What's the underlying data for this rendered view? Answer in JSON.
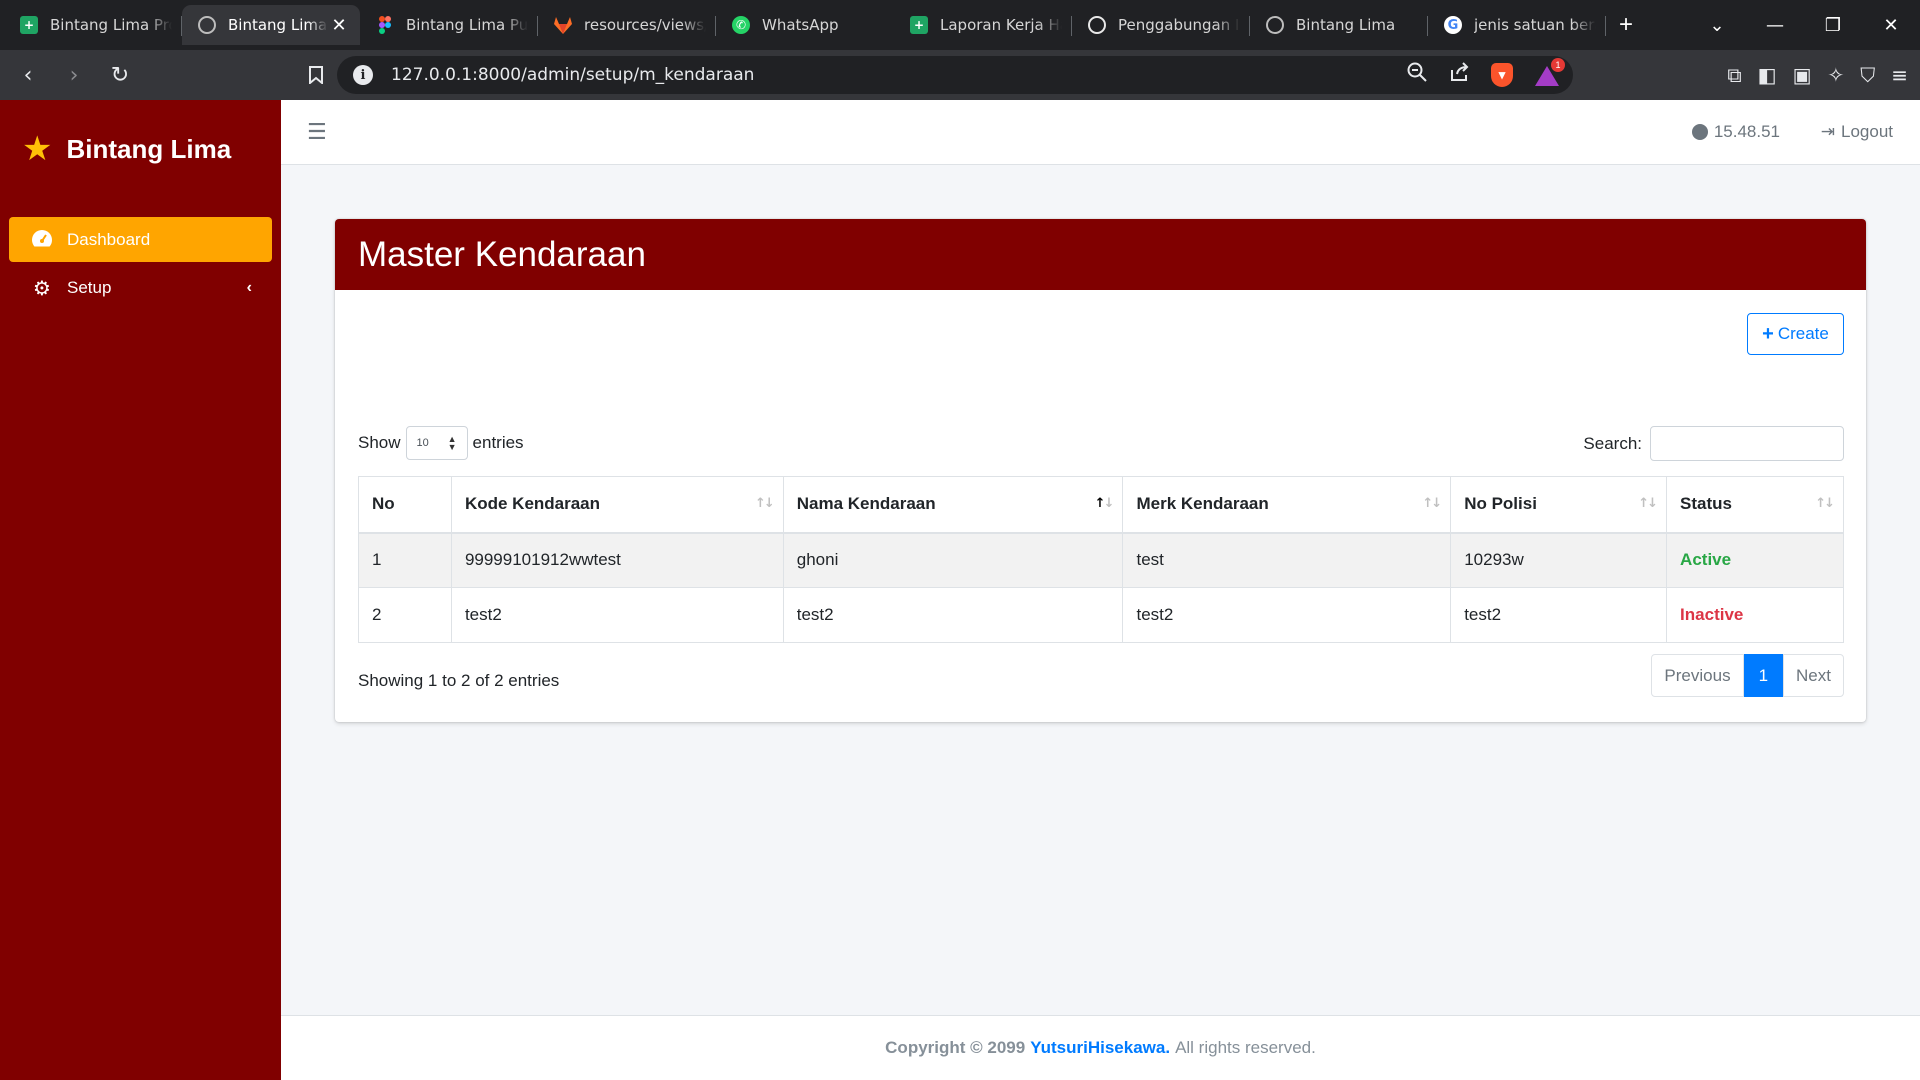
{
  "browser": {
    "tabs": [
      {
        "title": "Bintang Lima Proj",
        "icon": "sheets-icon",
        "active": false
      },
      {
        "title": "Bintang Lima",
        "icon": "globe-icon",
        "active": true
      },
      {
        "title": "Bintang Lima Putr",
        "icon": "figma-icon",
        "active": false
      },
      {
        "title": "resources/views/fr",
        "icon": "gitlab-icon",
        "active": false
      },
      {
        "title": "WhatsApp",
        "icon": "whatsapp-icon",
        "active": false
      },
      {
        "title": "Laporan Kerja Har",
        "icon": "sheets-icon",
        "active": false
      },
      {
        "title": "Penggabungan In",
        "icon": "chatgpt-icon",
        "active": false
      },
      {
        "title": "Bintang Lima",
        "icon": "globe-icon",
        "active": false
      },
      {
        "title": "jenis satuan berat",
        "icon": "google-icon",
        "active": false
      }
    ],
    "url": "127.0.0.1:8000/admin/setup/m_kendaraan",
    "rewards_count": "1"
  },
  "sidebar": {
    "brand": "Bintang Lima",
    "items": [
      {
        "label": "Dashboard",
        "icon": "tachometer-icon",
        "active": true
      },
      {
        "label": "Setup",
        "icon": "gear-icon",
        "active": false
      }
    ]
  },
  "topnav": {
    "time": "15.48.51",
    "logout_label": "Logout"
  },
  "page": {
    "title": "Master Kendaraan",
    "create_label": "Create",
    "show_label": "Show",
    "entries_label": "entries",
    "page_length": "10",
    "search_label": "Search:",
    "search_value": ""
  },
  "table": {
    "columns": [
      "No",
      "Kode Kendaraan",
      "Nama Kendaraan",
      "Merk Kendaraan",
      "No Polisi",
      "Status"
    ],
    "rows": [
      {
        "no": "1",
        "kode": "99999101912wwtest",
        "nama": "ghoni",
        "merk": "test",
        "polisi": "10293w",
        "status": "Active"
      },
      {
        "no": "2",
        "kode": "test2",
        "nama": "test2",
        "merk": "test2",
        "polisi": "test2",
        "status": "Inactive"
      }
    ],
    "info": "Showing 1 to 2 of 2 entries",
    "pagination": {
      "previous": "Previous",
      "current": "1",
      "next": "Next"
    }
  },
  "footer": {
    "copyright": "Copyright © 2099",
    "author": "YutsuriHisekawa.",
    "rights": "All rights reserved."
  },
  "colors": {
    "brand": "#800000",
    "active_nav": "#ffa500",
    "primary": "#007bff",
    "status_active": "#28a745",
    "status_inactive": "#dc3545"
  }
}
